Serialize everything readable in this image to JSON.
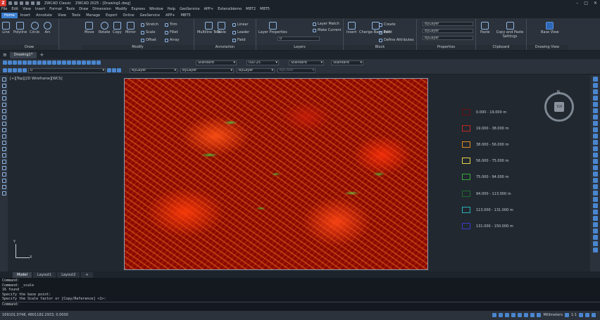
{
  "titlebar": {
    "workspace": "ZWCAD Classic",
    "title": "ZWCAD 2025 - [Drawing1.dwg]"
  },
  "menu": [
    "File",
    "Edit",
    "View",
    "Insert",
    "Format",
    "Tools",
    "Draw",
    "Dimension",
    "Modify",
    "Express",
    "Window",
    "Help",
    "GeoService",
    "APP+",
    "Extensiblemo",
    "MBT2",
    "MBT5"
  ],
  "ribbon_tabs": [
    "Home",
    "Insert",
    "Annotate",
    "View",
    "Tools",
    "Manage",
    "Export",
    "Online",
    "GeoService",
    "APP+",
    "MBT5"
  ],
  "ribbon": {
    "draw": {
      "title": "Draw",
      "tools": [
        "Line",
        "Polyline",
        "Circle",
        "Arc"
      ]
    },
    "modify": {
      "title": "Modify",
      "tools": [
        "Move",
        "Rotate",
        "Copy",
        "Mirror"
      ],
      "small": [
        "Stretch",
        "Scale",
        "Offset",
        "Trim",
        "Fillet",
        "Array"
      ]
    },
    "annotation": {
      "title": "Annotation",
      "tools": [
        "Multiline Text",
        "Table"
      ],
      "small": [
        "Linear",
        "Leader",
        "Field"
      ]
    },
    "layers": {
      "title": "Layers",
      "tools": [
        "Layer Properties"
      ],
      "small": [
        "Layer Match",
        "Make Current"
      ],
      "layer_value": "0"
    },
    "block": {
      "title": "Block",
      "tools": [
        "Insert",
        "Change Base Point"
      ],
      "small": [
        "Create",
        "Edit",
        "Define Attributes"
      ]
    },
    "properties": {
      "title": "Properties",
      "color": "ByLayer",
      "linetype": "ByLayer",
      "lineweight": "ByLayer"
    },
    "clipboard": {
      "title": "Clipboard",
      "tools": [
        "Paste",
        "Copy and Paste Settings"
      ]
    },
    "drawing_view": {
      "title": "Drawing View",
      "tools": [
        "Base View"
      ]
    }
  },
  "doc_tab": "Drawing1*",
  "toolbar": {
    "text_style": "Standard",
    "dim_style": "ISO-25",
    "table_style": "Standard",
    "mleader_style": "Standard",
    "layer": "0",
    "color": "ByLayer",
    "linetype": "ByLayer",
    "lineweight": "ByLayer",
    "plotstyle": "ByColor"
  },
  "viewport": {
    "label": "[+][Top][2D Wireframe][WCS]",
    "compass_n": "N",
    "viewcube": "TOP",
    "ucs_x": "X",
    "ucs_y": "Y"
  },
  "legend": [
    {
      "label": "0.000 - 19.000 m",
      "color": "#6a1010"
    },
    {
      "label": "19.000 - 38.000 m",
      "color": "#c02a1a"
    },
    {
      "label": "38.000 - 56.000 m",
      "color": "#e08a20"
    },
    {
      "label": "56.000 - 75.000 m",
      "color": "#e6d24a"
    },
    {
      "label": "75.000 - 94.000 m",
      "color": "#3aa83a"
    },
    {
      "label": "94.000 - 113.000 m",
      "color": "#1f6b2a"
    },
    {
      "label": "113.000 - 131.000 m",
      "color": "#2ab0b8"
    },
    {
      "label": "131.000 - 150.000 m",
      "color": "#3a3ac8"
    }
  ],
  "layout_tabs": [
    "Model",
    "Layout1",
    "Layout2"
  ],
  "command_lines": [
    "Command:",
    "Command: _scale",
    "16 found",
    "Specify the base point:",
    "Specify the Scale factor or [Copy/Reference] <1>:",
    "Command:"
  ],
  "status": {
    "coords": "169101.0748, 4801182.2933, 0.0000",
    "units": "Millimeters",
    "scale": "1:1"
  }
}
